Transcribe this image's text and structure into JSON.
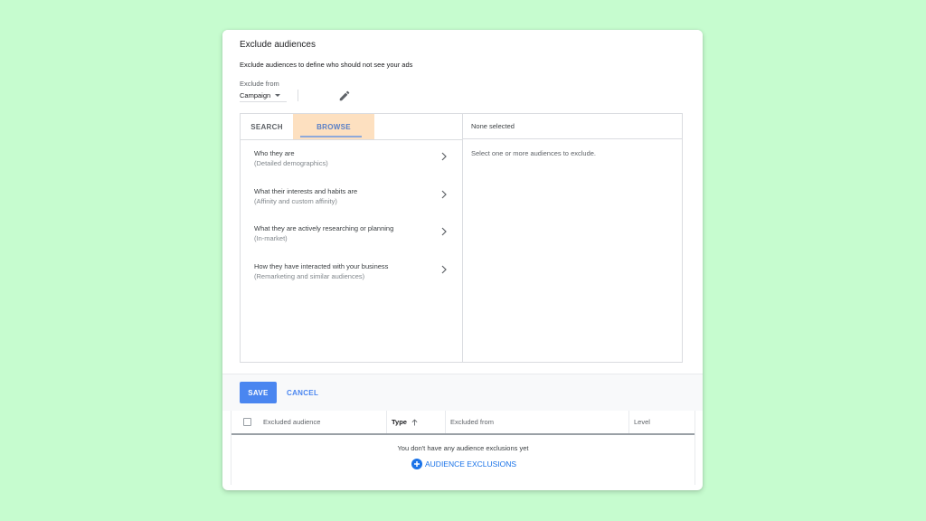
{
  "panel": {
    "title": "Exclude audiences",
    "description": "Exclude audiences to define who should not see your ads",
    "exclude_from_label": "Exclude from",
    "exclude_from_value": "Campaign"
  },
  "picker": {
    "tabs": [
      {
        "label": "SEARCH",
        "active": false
      },
      {
        "label": "BROWSE",
        "active": true
      }
    ],
    "categories": [
      {
        "title": "Who they are",
        "subtitle": "(Detailed demographics)"
      },
      {
        "title": "What their interests and habits are",
        "subtitle": "(Affinity and custom affinity)"
      },
      {
        "title": "What they are actively researching or planning",
        "subtitle": "(In-market)"
      },
      {
        "title": "How they have interacted with your business",
        "subtitle": "(Remarketing and similar audiences)"
      }
    ],
    "selected_header": "None selected",
    "selected_empty": "Select one or more audiences to exclude."
  },
  "actions": {
    "save_label": "SAVE",
    "cancel_label": "CANCEL"
  },
  "table": {
    "columns": [
      "Excluded audience",
      "Type",
      "Excluded from",
      "Level"
    ],
    "sorted_column": "Type",
    "empty_message": "You don't have any audience exclusions yet",
    "add_label": "AUDIENCE EXCLUSIONS"
  },
  "icons": {
    "scope": "caret-down-icon",
    "edit": "pencil-icon",
    "category": "chevron-right-icon",
    "sort": "arrow-up-icon",
    "add": "plus-circle-icon"
  },
  "colors": {
    "background": "#c6fccf",
    "primary": "#4a86f0",
    "link": "#1a73e8",
    "tab_highlight": "#fde0c0"
  }
}
